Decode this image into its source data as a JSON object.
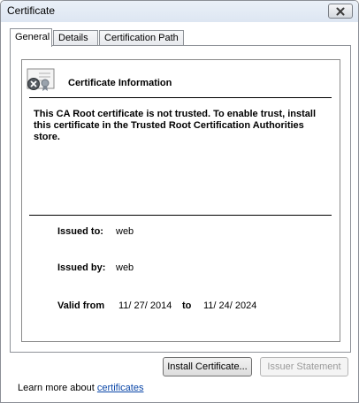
{
  "window": {
    "title": "Certificate"
  },
  "tabs": [
    {
      "label": "General"
    },
    {
      "label": "Details"
    },
    {
      "label": "Certification Path"
    }
  ],
  "info": {
    "heading": "Certificate Information",
    "warning": "This CA Root certificate is not trusted. To enable trust, install this certificate in the Trusted Root Certification Authorities store.",
    "issued_to_label": "Issued to:",
    "issued_to_value": "web",
    "issued_by_label": "Issued by:",
    "issued_by_value": "web",
    "valid_from_label": "Valid from",
    "valid_from_value": "11/ 27/ 2014",
    "valid_to_label": "to",
    "valid_to_value": "11/ 24/ 2024"
  },
  "buttons": {
    "install": "Install Certificate...",
    "issuer": "Issuer Statement"
  },
  "footer": {
    "learn_text": "Learn more about ",
    "learn_link": "certificates"
  }
}
